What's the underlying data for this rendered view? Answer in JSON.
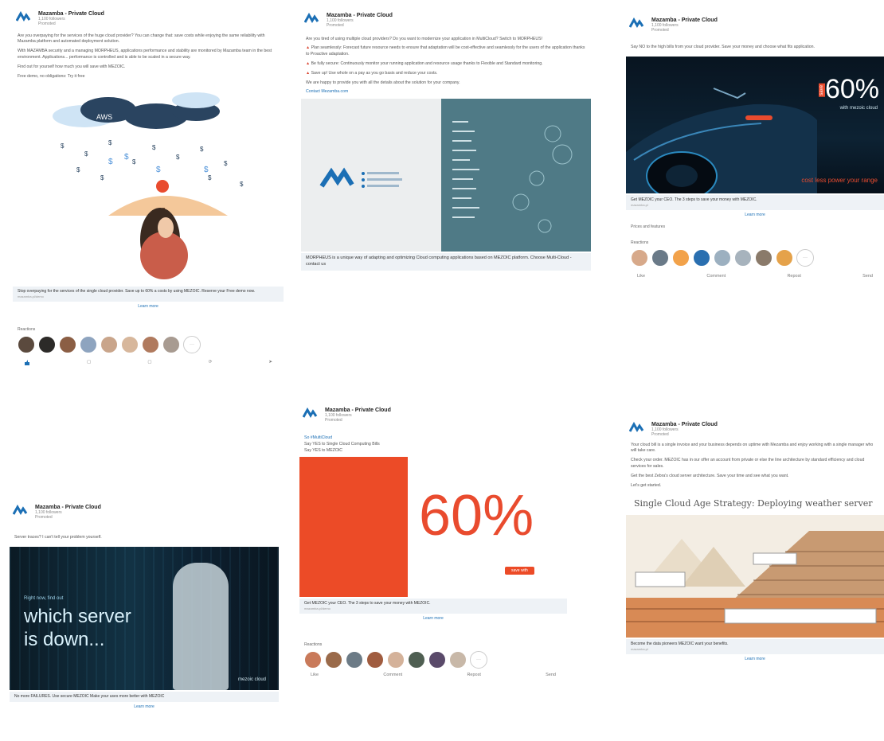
{
  "brand": {
    "name": "Mazamba - Private Cloud",
    "accent": "#1b6fb5",
    "orange": "#e94b2e"
  },
  "cards": [
    {
      "company": "Mazamba - Private Cloud",
      "followers": "1,100 followers",
      "time": "Promoted",
      "body": [
        "Are you overpaying for the services of the huge cloud provider? You can change that: save costs while enjoying the same reliability with Mazamba platform and automated deployment solution.",
        "With MAZAMBA security and a managing MORPHEUS, applications performance and stability are monitored by Mazamba team in the best environment. Applications... performance is controlled and is able to be scaled in a secure way.",
        "Find out for yourself how much you will save with MEZOIC.",
        "Free demo, no obligations: Try it free"
      ],
      "strip": "Stop overpaying for the services of the single cloud provider. Save up to 60% a costs by using MEZOIC. Reserve your Free demo now.",
      "strip_small": "mazamba.pl/demo",
      "learn": "Learn more",
      "reactions_label": "Reactions"
    },
    {
      "company": "Mazamba - Private Cloud",
      "followers": "1,100 followers",
      "time": "Promoted",
      "body": [
        "Are you tired of using multiple cloud providers? Do you want to modernize your application in MultiCloud? Switch to MORPHEUS!",
        "Plan seamlessly: Forecast future resource needs to ensure that adaptation will be cost-effective and seamlessly for the users of the application thanks to Proactive adaptation.",
        "Be fully secure: Continuously monitor your running application and resource usage thanks to Flexible and Standard monitoring.",
        "Save up! Use whole on a pay as you go basis and reduce your costs.",
        "We are happy to provide you with all the details about the solution for your company."
      ],
      "link": "Contact Mezamba.com",
      "strip": "MORPHEUS is a unique way of adapting and optimizing Cloud computing applications based on MEZOIC platform. Choose Multi-Cloud - contact us"
    },
    {
      "company": "Mazamba - Private Cloud",
      "followers": "1,100 followers",
      "time": "Promoted",
      "body": "Say NO to the high bills from your cloud provider. Save your money and choose what fits application.",
      "banner_pct": "60%",
      "banner_save": "save",
      "banner_sub": "with mezoic cloud",
      "banner_foot": "cost less power your range",
      "strip": "Get MEZOIC your CEO. The 3 steps to save your money with MEZOIC.",
      "strip_small": "mazamba.pl",
      "learn": "Learn more",
      "reactions_line": "Prices and features",
      "reactions_label": "Reactions",
      "actions": [
        "Like",
        "Comment",
        "Repost",
        "Send"
      ]
    },
    {
      "company": "Mazamba - Private Cloud",
      "followers": "1,100 followers",
      "time": "Promoted",
      "body": "Server traces? I can't tell your problem yourself.",
      "hero_small": "Right now, find out",
      "hero_big": "which server is down...",
      "hero_brand": "mezoic cloud",
      "strip": "No more FAILURES. Use secure MEZOIC Make your uses more better with MEZOIC",
      "learn": "Learn more"
    },
    {
      "company": "Mazamba - Private Cloud",
      "followers": "1,100 followers",
      "time": "Promoted",
      "lines": [
        "So #MultiCloud",
        "Say YES to Single Cloud Computing Bills",
        "Say YES to MEZOIC"
      ],
      "pct": "60%",
      "badge": "save with",
      "strip": "Get MEZOIC your CEO. The 3 steps to save your money with MEZOIC.",
      "strip_small": "mazamba.pl/demo",
      "learn": "Learn more",
      "reactions_label": "Reactions",
      "actions": [
        "Like",
        "Comment",
        "Repost",
        "Send"
      ]
    },
    {
      "company": "Mazamba - Private Cloud",
      "followers": "1,100 followers",
      "time": "Promoted",
      "body": [
        "Your cloud bill is a single invoice and your business depends on uptime with Mezamba and enjoy working with a single manager who will take care.",
        "Check your order. MEZOIC has in our offer an account from private or else the line architecture by standard efficiency and cloud services for sales.",
        "Get the best Zebra's cloud server architecture. Save your time and see what you want.",
        "Let's get started."
      ],
      "figure_title": "Single Cloud Age Strategy: Deploying weather server",
      "strip": "Become the data pioneers MEZOIC want your benefits.",
      "strip_small": "mazamba.pl",
      "learn": "Learn more"
    }
  ]
}
